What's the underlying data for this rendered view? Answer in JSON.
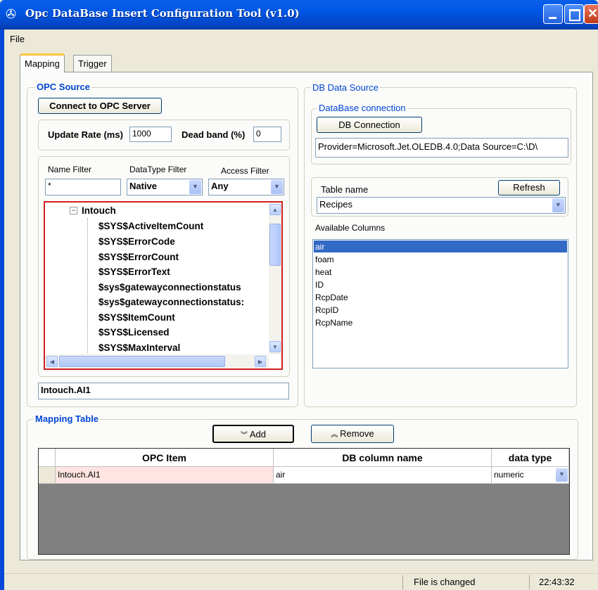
{
  "window": {
    "title": "Opc DataBase Insert Configuration Tool (v1.0)"
  },
  "menu": {
    "file": "File"
  },
  "tabs": [
    "Mapping",
    "Trigger"
  ],
  "opc_source": {
    "label": "OPC Source",
    "connect_button": "Connect to OPC Server",
    "update_rate_label": "Update Rate (ms)",
    "update_rate_value": "1000",
    "dead_band_label": "Dead band (%)",
    "dead_band_value": "0",
    "name_filter_label": "Name Filter",
    "name_filter_value": "*",
    "datatype_filter_label": "DataType Filter",
    "datatype_filter_value": "Native",
    "access_filter_label": "Access Filter",
    "access_filter_value": "Any",
    "tree_root": "Intouch",
    "tree_items": [
      "$SYS$ActiveItemCount",
      "$SYS$ErrorCode",
      "$SYS$ErrorCount",
      "$SYS$ErrorText",
      "$sys$gatewayconnectionstatus",
      "$sys$gatewayconnectionstatus:",
      "$SYS$ItemCount",
      "$SYS$Licensed",
      "$SYS$MaxInterval"
    ],
    "selected_item": "Intouch.AI1"
  },
  "db_source": {
    "label": "DB Data Source",
    "connection_label": "DataBase connection",
    "connection_button": "DB Connection",
    "connection_string": "Provider=Microsoft.Jet.OLEDB.4.0;Data Source=C:\\D\\",
    "table_name_label": "Table name",
    "refresh_button": "Refresh",
    "table_value": "Recipes",
    "available_columns_label": "Available Columns",
    "columns": [
      "air",
      "foam",
      "heat",
      "ID",
      "RcpDate",
      "RcpID",
      "RcpName"
    ],
    "selected_column": "air"
  },
  "mapping_table": {
    "label": "Mapping Table",
    "add_button": "Add",
    "remove_button": "Remove",
    "headers": [
      "OPC Item",
      "DB column name",
      "data type"
    ],
    "rows": [
      {
        "opc_item": "Intouch.AI1",
        "db_column": "air",
        "data_type": "numeric"
      }
    ]
  },
  "status": {
    "message": "File is changed",
    "time": "22:43:32"
  },
  "colors": {
    "title_bar": "#0058e6",
    "group_label": "#0046d5",
    "selection": "#316ac5",
    "tree_border": "#d02020",
    "opc_cell": "#ffe4e1"
  }
}
